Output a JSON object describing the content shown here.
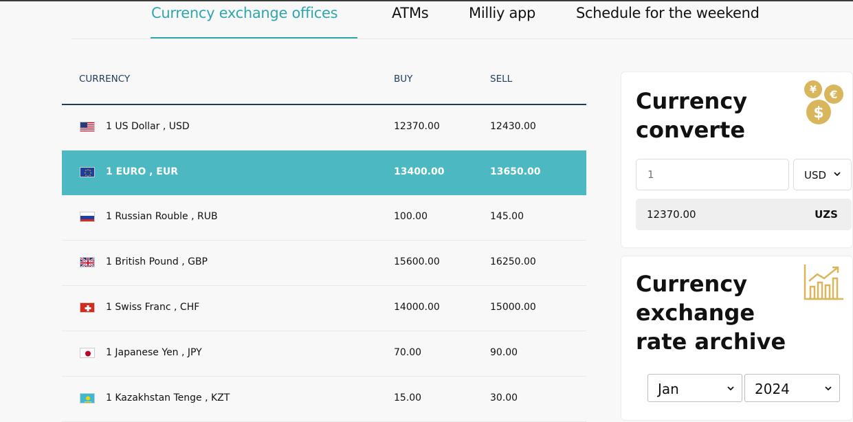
{
  "tabs": [
    {
      "label": "Currency exchange offices",
      "active": true
    },
    {
      "label": "ATMs",
      "active": false
    },
    {
      "label": "Milliy app",
      "active": false
    },
    {
      "label": "Schedule for the weekend",
      "active": false
    }
  ],
  "table": {
    "headers": {
      "currency": "CURRENCY",
      "buy": "BUY",
      "sell": "SELL"
    },
    "rows": [
      {
        "flag": "us-flag",
        "name": "1 US Dollar , USD",
        "buy": "12370.00",
        "sell": "12430.00",
        "highlighted": false
      },
      {
        "flag": "eu-flag",
        "name": "1 EURO , EUR",
        "buy": "13400.00",
        "sell": "13650.00",
        "highlighted": true
      },
      {
        "flag": "ru-flag",
        "name": "1 Russian Rouble , RUB",
        "buy": "100.00",
        "sell": "145.00",
        "highlighted": false
      },
      {
        "flag": "gb-flag",
        "name": "1 British Pound , GBP",
        "buy": "15600.00",
        "sell": "16250.00",
        "highlighted": false
      },
      {
        "flag": "ch-flag",
        "name": "1 Swiss Franc , CHF",
        "buy": "14000.00",
        "sell": "15000.00",
        "highlighted": false
      },
      {
        "flag": "jp-flag",
        "name": "1 Japanese Yen , JPY",
        "buy": "70.00",
        "sell": "90.00",
        "highlighted": false
      },
      {
        "flag": "kz-flag",
        "name": "1 Kazakhstan Tenge , KZT",
        "buy": "15.00",
        "sell": "30.00",
        "highlighted": false
      }
    ]
  },
  "converter": {
    "title": "Currency converte",
    "icon": "coins-icon",
    "amount_placeholder": "1",
    "currency": "USD",
    "result_value": "12370.00",
    "result_unit": "UZS"
  },
  "archive": {
    "title": "Currency exchange rate archive",
    "icon": "chart-growth-icon",
    "month": "Jan",
    "year": "2024"
  },
  "colors": {
    "accent": "#2fa6ad",
    "highlight_row": "#4cb8c2",
    "header_text": "#1f3a5c",
    "icon_gold": "#d9b65c"
  }
}
